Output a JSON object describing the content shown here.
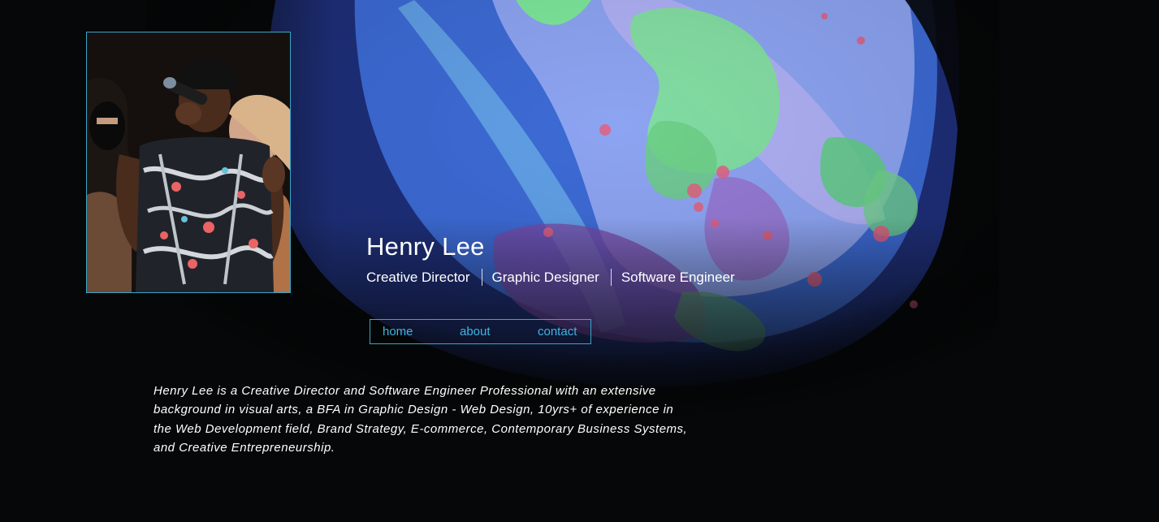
{
  "profile": {
    "name": "Henry Lee",
    "photo_alt": "Henry Lee performing with microphone",
    "roles": [
      "Creative Director",
      "Graphic Designer",
      "Software Engineer"
    ]
  },
  "nav": {
    "items": [
      {
        "label": "home"
      },
      {
        "label": "about"
      },
      {
        "label": "contact"
      }
    ]
  },
  "bio": {
    "text": "Henry Lee is a Creative Director and Software Engineer Professional with an extensive background in visual arts, a BFA in Graphic Design - Web Design, 10yrs+ of experience in the Web Development field, Brand Strategy, E-commerce, Contemporary Business Systems, and Creative Entrepreneurship."
  },
  "colors": {
    "background": "#050708",
    "accent": "#3aa6c9",
    "nav_text": "#41b3df",
    "text": "#ffffff"
  }
}
